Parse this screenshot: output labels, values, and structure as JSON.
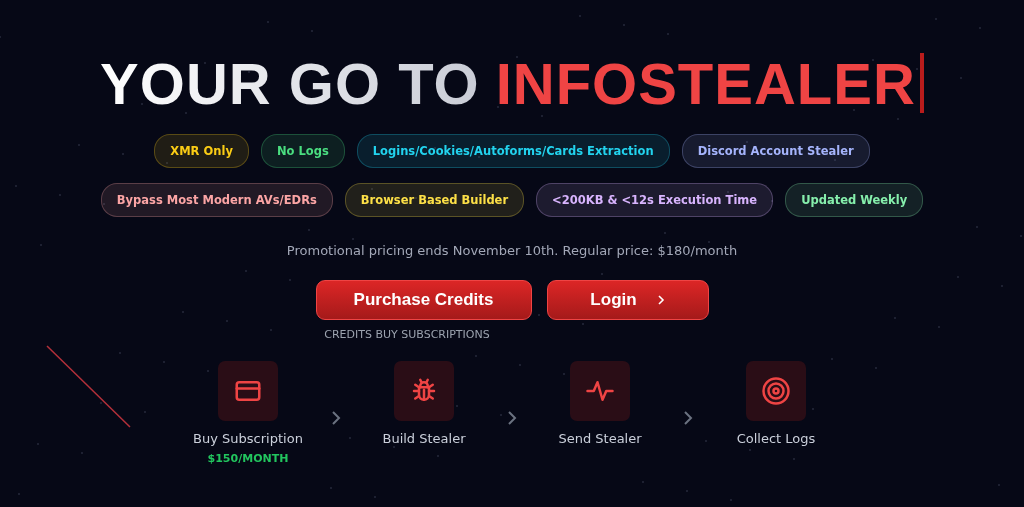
{
  "hero": {
    "title_lead": "YOUR GO TO",
    "title_highlight": "INFOSTEALER"
  },
  "tag_rows": [
    [
      {
        "label": "XMR Only",
        "color": "#facc15"
      },
      {
        "label": "No Logs",
        "color": "#4ade80"
      },
      {
        "label": "Logins/Cookies/Autoforms/Cards Extraction",
        "color": "#22d3ee"
      },
      {
        "label": "Discord Account Stealer",
        "color": "#a5b4fc"
      }
    ],
    [
      {
        "label": "Bypass Most Modern AVs/EDRs",
        "color": "#fca5a5"
      },
      {
        "label": "Browser Based Builder",
        "color": "#fde047"
      },
      {
        "label": "<200KB & <12s Execution Time",
        "color": "#d8b4fe"
      },
      {
        "label": "Updated Weekly",
        "color": "#86efac"
      }
    ]
  ],
  "promo_note": "Promotional pricing ends November 10th. Regular price: $180/month",
  "buttons": [
    {
      "label": "Purchase Credits",
      "chevron": false
    },
    {
      "label": "Login",
      "chevron": true
    }
  ],
  "caption": "CREDITS BUY SUBSCRIPTIONS",
  "steps": [
    {
      "kind": "card",
      "label": "Buy Subscription",
      "price": "$150/MONTH"
    },
    {
      "kind": "bug",
      "label": "Build Stealer"
    },
    {
      "kind": "pulse",
      "label": "Send Stealer"
    },
    {
      "kind": "target",
      "label": "Collect Logs"
    }
  ]
}
